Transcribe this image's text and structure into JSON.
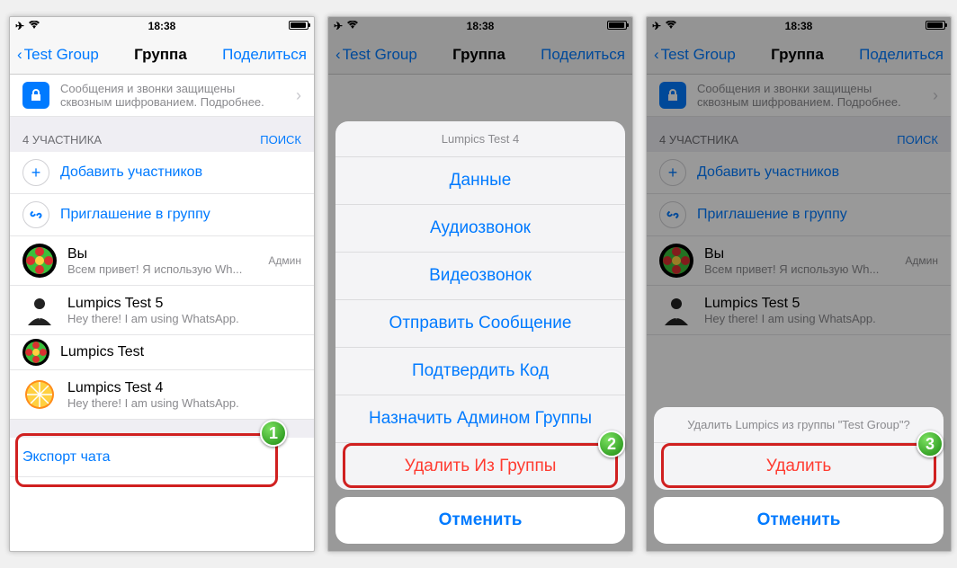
{
  "status": {
    "time": "18:38",
    "airplane": "✈",
    "wifi": "📶"
  },
  "nav": {
    "back": "Test Group",
    "title": "Группа",
    "share": "Поделиться"
  },
  "encryption": "Сообщения и звонки защищены сквозным шифрованием. Подробнее.",
  "section": {
    "count": "4 УЧАСТНИКА",
    "search": "ПОИСК"
  },
  "actions": {
    "add": "Добавить участников",
    "invite": "Приглашение в группу"
  },
  "participants": [
    {
      "name": "Вы",
      "status": "Всем привет! Я использую Wh...",
      "admin": "Админ",
      "avatar": "green-flower"
    },
    {
      "name": "Lumpics Test 5",
      "status": "Hey there! I am using WhatsApp.",
      "avatar": "suit"
    },
    {
      "name": "Lumpics Test",
      "status": "",
      "avatar": "green-flower"
    },
    {
      "name": "Lumpics Test 4",
      "status": "Hey there! I am using WhatsApp.",
      "avatar": "citrus"
    }
  ],
  "export": "Экспорт чата",
  "sheet1": {
    "title": "Lumpics Test 4",
    "items": [
      "Данные",
      "Аудиозвонок",
      "Видеозвонок",
      "Отправить Сообщение",
      "Подтвердить Код",
      "Назначить Админом Группы"
    ],
    "remove": "Удалить Из Группы",
    "cancel": "Отменить"
  },
  "sheet2": {
    "prompt": "Удалить Lumpics из группы \"Test Group\"?",
    "delete": "Удалить",
    "cancel": "Отменить"
  },
  "badges": {
    "b1": "1",
    "b2": "2",
    "b3": "3"
  }
}
